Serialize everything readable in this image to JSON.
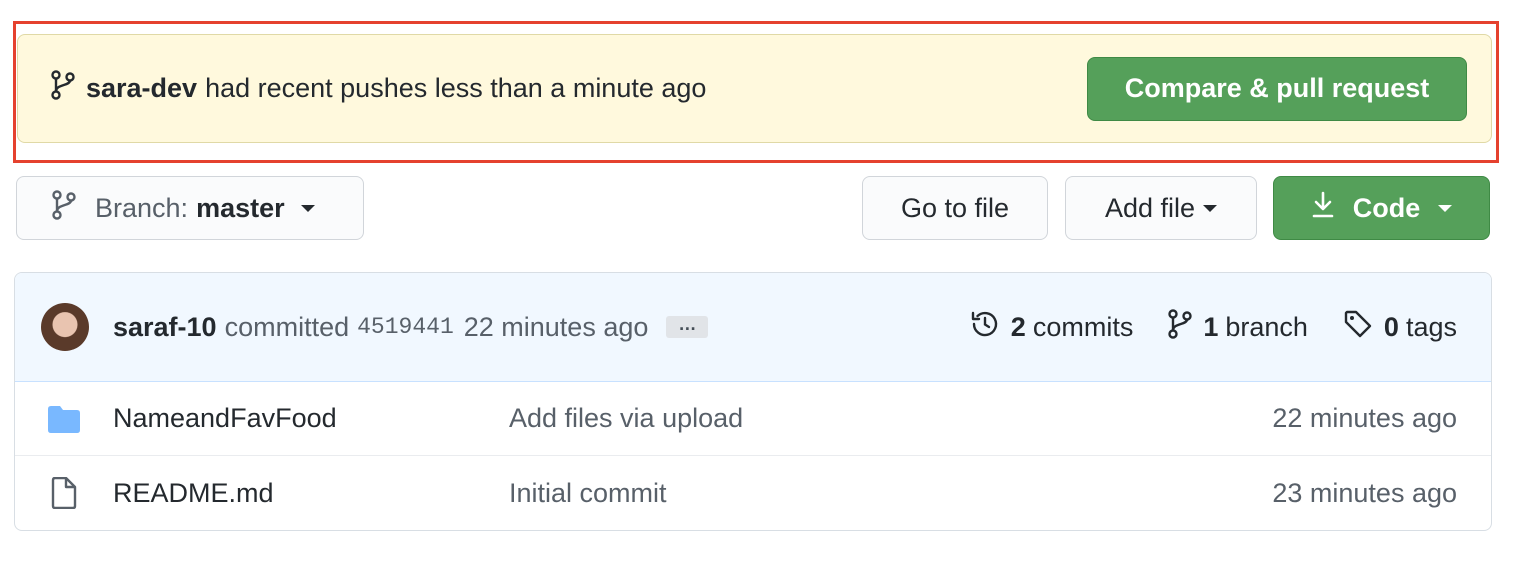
{
  "banner": {
    "user": "sara-dev",
    "message": "had recent pushes less than a minute ago",
    "button": "Compare & pull request"
  },
  "toolbar": {
    "branch_label": "Branch:",
    "branch_value": "master",
    "goto_file": "Go to file",
    "add_file": "Add file",
    "code": "Code"
  },
  "commit": {
    "author": "saraf-10",
    "verb": "committed",
    "sha": "4519441",
    "time": "22 minutes ago",
    "ellipsis": "…"
  },
  "stats": {
    "commits_count": "2",
    "commits_label": "commits",
    "branches_count": "1",
    "branches_label": "branch",
    "tags_count": "0",
    "tags_label": "tags"
  },
  "files": [
    {
      "type": "folder",
      "icon": "folder-icon",
      "name": "NameandFavFood",
      "message": "Add files via upload",
      "age": "22 minutes ago"
    },
    {
      "type": "file",
      "icon": "file-icon",
      "name": "README.md",
      "message": "Initial commit",
      "age": "23 minutes ago"
    }
  ],
  "colors": {
    "banner_bg": "#fff9dd",
    "highlight_border": "#e5412e",
    "primary_green": "#55a05a",
    "commit_header_bg": "#f1f8ff",
    "folder_blue": "#79b8ff"
  }
}
